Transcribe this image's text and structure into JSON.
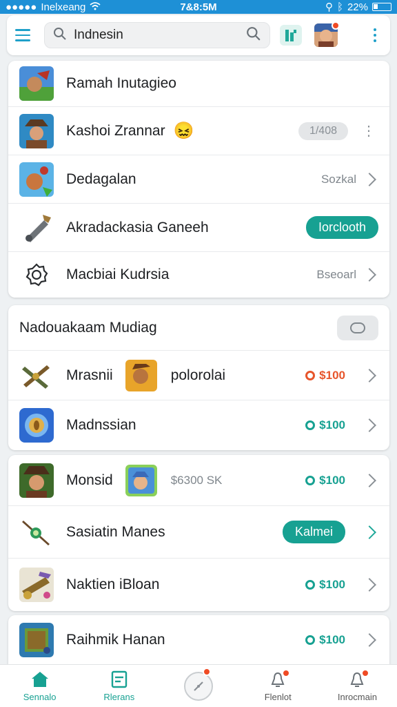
{
  "status": {
    "carrier": "Inelxeang",
    "time": "7&8:5M",
    "battery": "22%"
  },
  "search": {
    "value": "Indnesin"
  },
  "card1": {
    "rows": [
      {
        "label": "Ramah Inutagieo"
      },
      {
        "label": "Kashoi Zrannar",
        "pill": "1/408"
      },
      {
        "label": "Dedagalan",
        "meta": "Sozkal"
      },
      {
        "label": "Akradackasia Ganeeh",
        "action": "Iorclooth"
      },
      {
        "label": "Macbiai Kudrsia",
        "meta": "Bseoarl"
      }
    ]
  },
  "card2": {
    "header": "Nadouakaam Mudiag",
    "rows": [
      {
        "label": "Mrasnii",
        "extra": "polorolai",
        "price": "$100"
      },
      {
        "label": "Madnssian",
        "price": "$100"
      }
    ]
  },
  "card3": {
    "rows": [
      {
        "label": "Monsid",
        "extra": "$6300 SK",
        "price": "$100"
      },
      {
        "label": "Sasiatin Manes",
        "action": "Kalmei"
      },
      {
        "label": "Naktien iBloan",
        "price": "$100"
      }
    ]
  },
  "card4": {
    "rows": [
      {
        "label": "Raihmik Hanan",
        "price": "$100"
      }
    ]
  },
  "nav": {
    "items": [
      {
        "label": "Sennalo"
      },
      {
        "label": "Rlerans"
      },
      {
        "label": ""
      },
      {
        "label": "Flenlot"
      },
      {
        "label": "Inrocmain"
      }
    ]
  },
  "colors": {
    "accent": "#17a192",
    "statusbar": "#1e90d6",
    "badge": "#ef4a24",
    "price_orange": "#e7552b"
  }
}
